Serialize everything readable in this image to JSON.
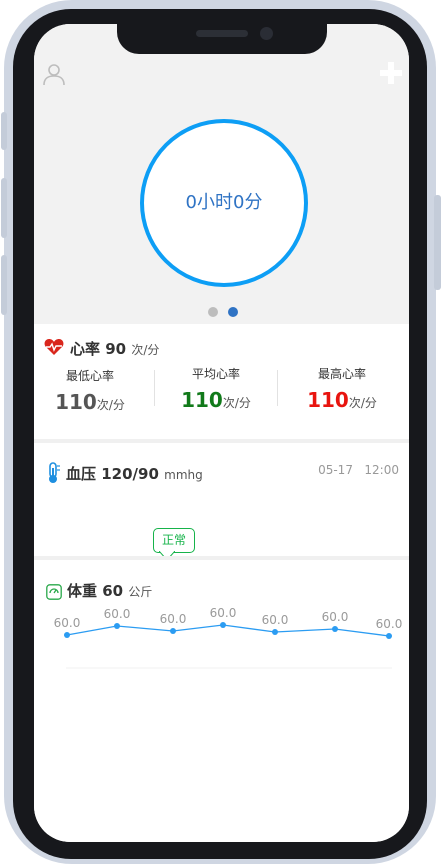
{
  "hero": {
    "ring_text": "0小时0分",
    "accent_color": "#0d9ef5",
    "dots": [
      {
        "active": false
      },
      {
        "active": true
      }
    ],
    "icons": {
      "left": "user-icon",
      "right": "plus-icon"
    }
  },
  "heart_rate": {
    "icon": "heart-pulse-icon",
    "title": "心率",
    "value": "90",
    "unit": "次/分",
    "columns": [
      {
        "label": "最低心率",
        "value": "110",
        "unit": "次/分",
        "color": "#555555"
      },
      {
        "label": "平均心率",
        "value": "110",
        "unit": "次/分",
        "color": "#117a1a"
      },
      {
        "label": "最高心率",
        "value": "110",
        "unit": "次/分",
        "color": "#e8140f"
      }
    ]
  },
  "blood_pressure": {
    "icon": "thermometer-icon",
    "title": "血压",
    "value": "120/90",
    "unit": "mmhg",
    "date": "05-17",
    "time": "12:00",
    "status": "正常",
    "scale_colors": [
      "#cccccc",
      "#16b34a",
      "#1e8fe0",
      "#f0923a",
      "#d80f0f"
    ]
  },
  "weight": {
    "icon": "scale-icon",
    "title": "体重",
    "value": "60",
    "unit": "公斤",
    "chart_data": {
      "type": "line",
      "values": [
        60.0,
        60.0,
        60.0,
        60.0,
        60.0,
        60.0,
        60.0
      ],
      "labels": [
        "60.0",
        "60.0",
        "60.0",
        "60.0",
        "60.0",
        "60.0",
        "60.0"
      ],
      "line_color": "#2b9cf2"
    }
  }
}
